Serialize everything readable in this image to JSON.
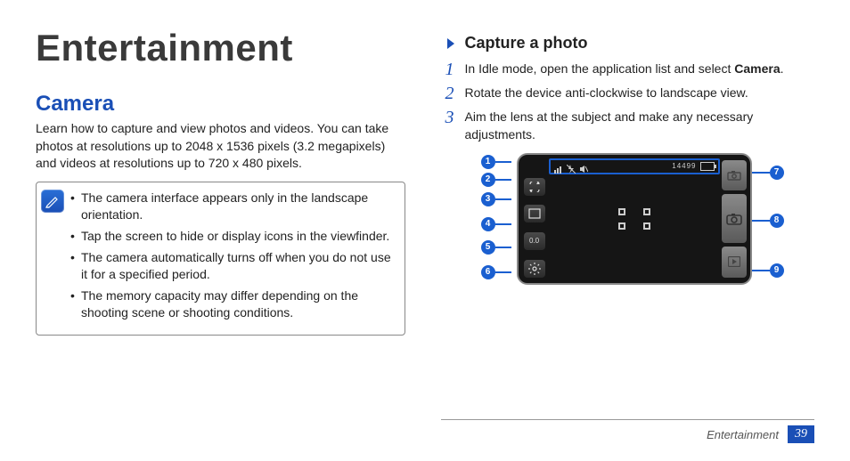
{
  "chapter_title": "Entertainment",
  "left": {
    "section_title": "Camera",
    "intro": "Learn how to capture and view photos and videos. You can take photos at resolutions up to 2048 x 1536 pixels (3.2 megapixels) and videos at resolutions up to 720 x 480 pixels.",
    "notes": [
      "The camera interface appears only in the landscape orientation.",
      "Tap the screen to hide or display icons in the viewfinder.",
      "The camera automatically turns off when you do not use it for a specified period.",
      "The memory capacity may differ depending on the shooting scene or shooting conditions."
    ]
  },
  "right": {
    "sub_heading": "Capture a photo",
    "steps": [
      {
        "num": "1",
        "text_pre": "In Idle mode, open the application list and select ",
        "bold": "Camera",
        "text_post": "."
      },
      {
        "num": "2",
        "text_pre": "Rotate the device anti-clockwise to landscape view.",
        "bold": "",
        "text_post": ""
      },
      {
        "num": "3",
        "text_pre": "Aim the lens at the subject and make any necessary adjustments.",
        "bold": "",
        "text_post": ""
      }
    ],
    "diagram": {
      "status_counter": "14499",
      "ev_label": "0.0",
      "callouts_left": [
        "1",
        "2",
        "3",
        "4",
        "5",
        "6"
      ],
      "callouts_right": [
        "7",
        "8",
        "9"
      ]
    }
  },
  "footer": {
    "label": "Entertainment",
    "page": "39"
  }
}
